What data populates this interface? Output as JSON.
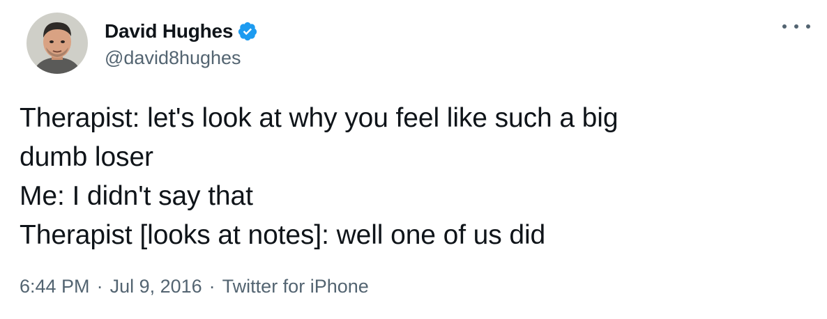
{
  "user": {
    "display_name": "David Hughes",
    "handle": "@david8hughes",
    "verified": true,
    "avatar_icon": "profile-photo"
  },
  "tweet": {
    "lines": [
      "Therapist: let's look at why you feel like such a big",
      "dumb loser",
      "Me: I didn't say that",
      "Therapist [looks at notes]: well one of us did"
    ]
  },
  "meta": {
    "time": "6:44 PM",
    "date": "Jul 9, 2016",
    "source": "Twitter for iPhone",
    "separator": "·"
  },
  "colors": {
    "text": "#0f1419",
    "secondary": "#536471",
    "verified": "#1d9bf0"
  }
}
